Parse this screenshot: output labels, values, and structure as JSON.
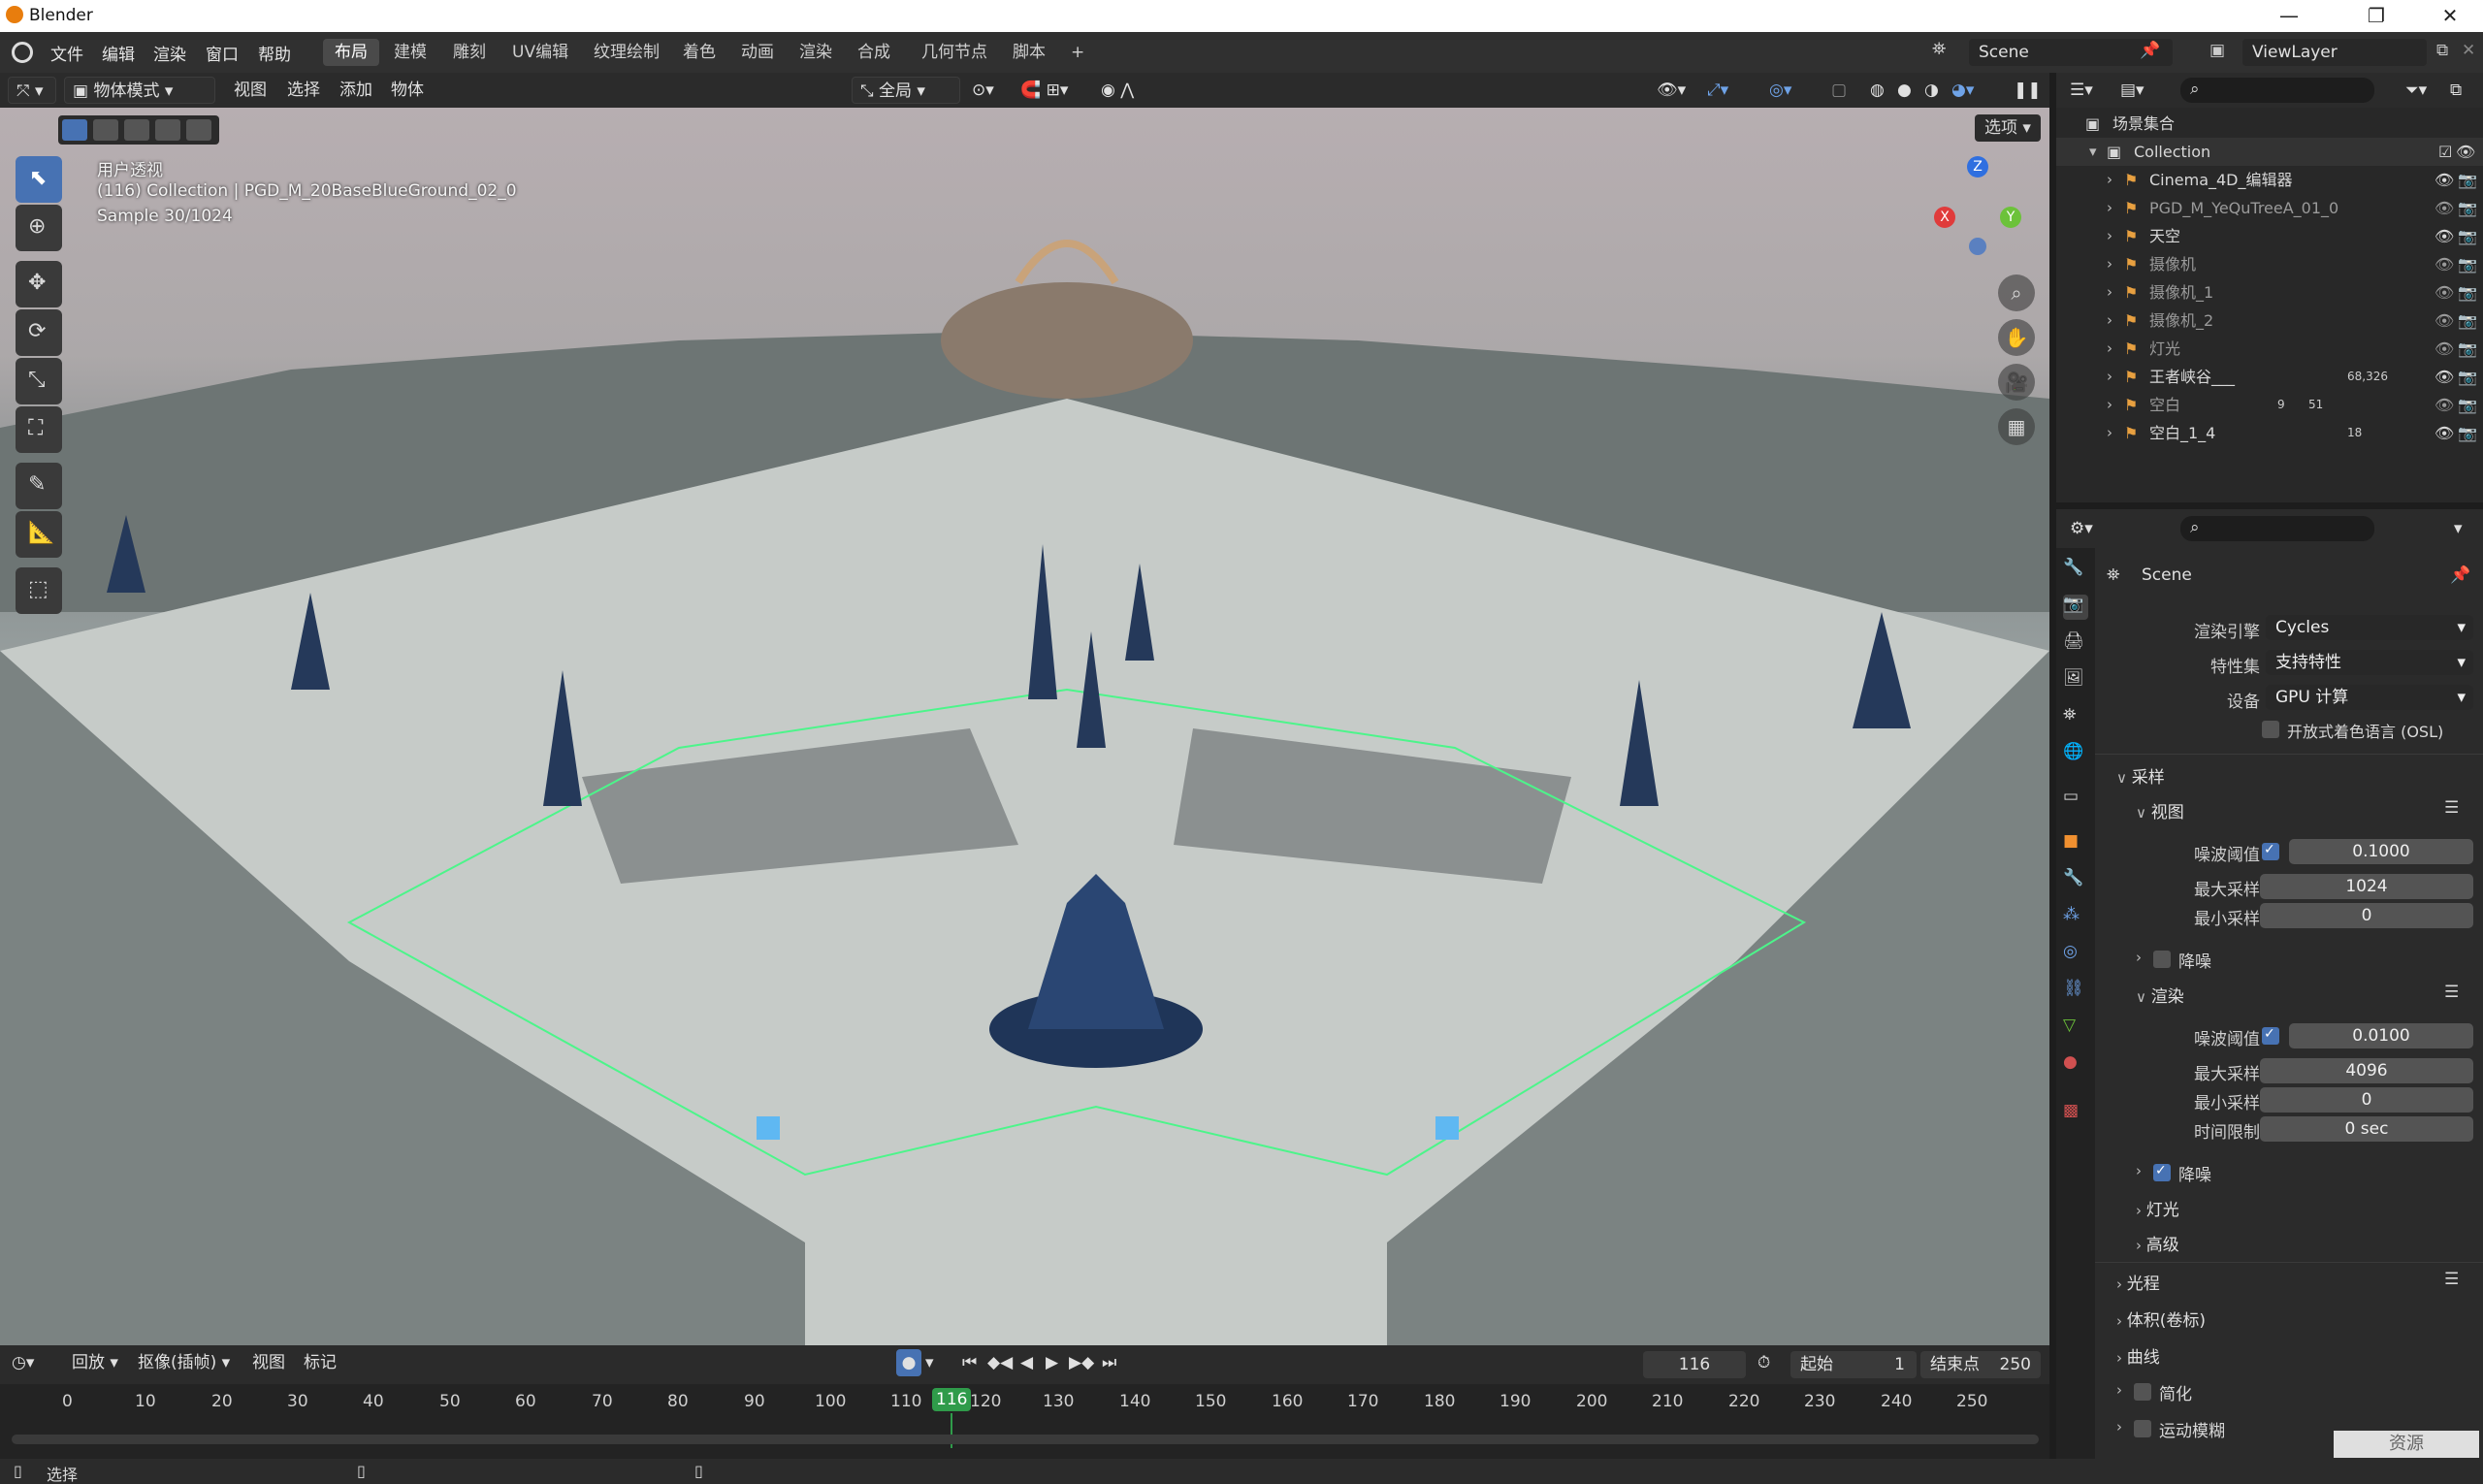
{
  "app": {
    "title": "Blender"
  },
  "menubar": {
    "items": [
      "文件",
      "编辑",
      "渲染",
      "窗口",
      "帮助"
    ],
    "workspaces": [
      "布局",
      "建模",
      "雕刻",
      "UV编辑",
      "纹理绘制",
      "着色",
      "动画",
      "渲染",
      "合成",
      "几何节点",
      "脚本"
    ],
    "add_tab": "+",
    "scene": "Scene",
    "view_layer": "ViewLayer"
  },
  "viewport_header": {
    "mode": "物体模式",
    "menus": [
      "视图",
      "选择",
      "添加",
      "物体"
    ],
    "transform_orientation": "全局",
    "options_label": "选项"
  },
  "viewport": {
    "overlay_line1": "用户透视",
    "overlay_line2": "(116) Collection | PGD_M_20BaseBlueGround_02_0",
    "overlay_line3": "Sample 30/1024",
    "gizmo": {
      "x": "X",
      "y": "Y",
      "z": "Z"
    }
  },
  "timeline": {
    "playback": "回放",
    "keying": "抠像(插帧)",
    "view": "视图",
    "marker": "标记",
    "current_frame": "116",
    "start_label": "起始",
    "start_value": "1",
    "end_label": "结束点",
    "end_value": "250",
    "ticks": [
      "0",
      "10",
      "20",
      "30",
      "40",
      "50",
      "60",
      "70",
      "80",
      "90",
      "100",
      "110",
      "116",
      "120",
      "130",
      "140",
      "150",
      "160",
      "170",
      "180",
      "190",
      "200",
      "210",
      "220",
      "230",
      "240",
      "250"
    ],
    "playhead_color": "#2f9b4a"
  },
  "statusbar": {
    "left": "选择"
  },
  "outliner": {
    "root": "场景集合",
    "collection": "Collection",
    "items": [
      {
        "name": "Cinema_4D_编辑器",
        "dim": false
      },
      {
        "name": "PGD_M_YeQuTreeA_01_0",
        "dim": true
      },
      {
        "name": "天空",
        "dim": false
      },
      {
        "name": "摄像机",
        "dim": true
      },
      {
        "name": "摄像机_1",
        "dim": true
      },
      {
        "name": "摄像机_2",
        "dim": true
      },
      {
        "name": "灯光",
        "dim": true
      },
      {
        "name": "王者峡谷___",
        "dim": false,
        "badge": "68,326"
      },
      {
        "name": "空白",
        "dim": true,
        "badge": "9",
        "badge2": "51"
      },
      {
        "name": "空白_1_4",
        "dim": false,
        "badge": "18"
      }
    ]
  },
  "properties": {
    "context": "Scene",
    "render_engine_label": "渲染引擎",
    "render_engine": "Cycles",
    "feature_set_label": "特性集",
    "feature_set": "支持特性",
    "device_label": "设备",
    "device": "GPU 计算",
    "osl_label": "开放式着色语言 (OSL)",
    "sampling": "采样",
    "viewport_section": "视图",
    "noise_threshold_label": "噪波阈值",
    "viewport_noise_threshold": "0.1000",
    "max_samples_label": "最大采样",
    "viewport_max_samples": "1024",
    "min_samples_label": "最小采样",
    "viewport_min_samples": "0",
    "denoise_label": "降噪",
    "render_section": "渲染",
    "render_noise_threshold": "0.0100",
    "render_max_samples": "4096",
    "render_min_samples": "0",
    "time_limit_label": "时间限制",
    "time_limit": "0 sec",
    "lights": "灯光",
    "advanced": "高级",
    "light_paths": "光程",
    "volumes": "体积(卷标)",
    "curves": "曲线",
    "simplify": "简化",
    "motion_blur": "运动模糊"
  },
  "watermark": "资源"
}
